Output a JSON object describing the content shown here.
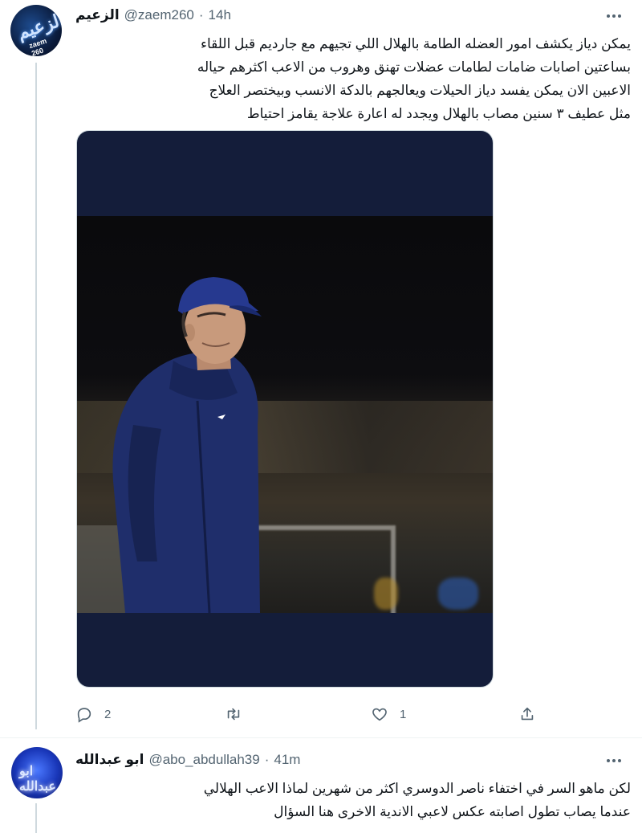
{
  "tweet1": {
    "display_name": "الزعيم",
    "handle": "@zaem260",
    "separator": "·",
    "time": "14h",
    "avatar_text": "الزعيم",
    "avatar_sub": "zaem 260",
    "text_lines": [
      "يمكن دياز يكشف امور العضله الطامة بالهلال اللي تجيهم مع جارديم قبل اللقاء",
      "بساعتين اصابات ضامات لطامات عضلات تهنق وهروب من الاعب اكثرهم حياله",
      "الاعبين الان  يمكن يفسد دياز الحيلات ويعالجهم بالدكة الانسب  وبيختصر العلاج",
      "مثل عطيف ٣ سنين مصاب بالهلال ويجدد له اعارة علاجة يقامز احتياط"
    ],
    "media": {
      "description_icon": "photo-coach"
    },
    "actions": {
      "reply_count": "2",
      "retweet_count": "",
      "like_count": "1",
      "share_count": ""
    }
  },
  "tweet2": {
    "display_name": "ابو عبدالله",
    "handle": "@abo_abdullah39",
    "separator": "·",
    "time": "41m",
    "avatar_text": "ابو عبدالله",
    "text_lines": [
      "لكن ماهو السر في اختفاء ناصر الدوسري اكثر من شهرين لماذا الاعب الهلالي",
      "عندما يصاب تطول اصابته عكس لاعبي الاندية الاخرى هنا السؤال"
    ]
  },
  "colors": {
    "text_primary": "#0f1419",
    "text_secondary": "#536471",
    "thread_line": "#cfd9de",
    "media_frame": "#141d3a"
  }
}
